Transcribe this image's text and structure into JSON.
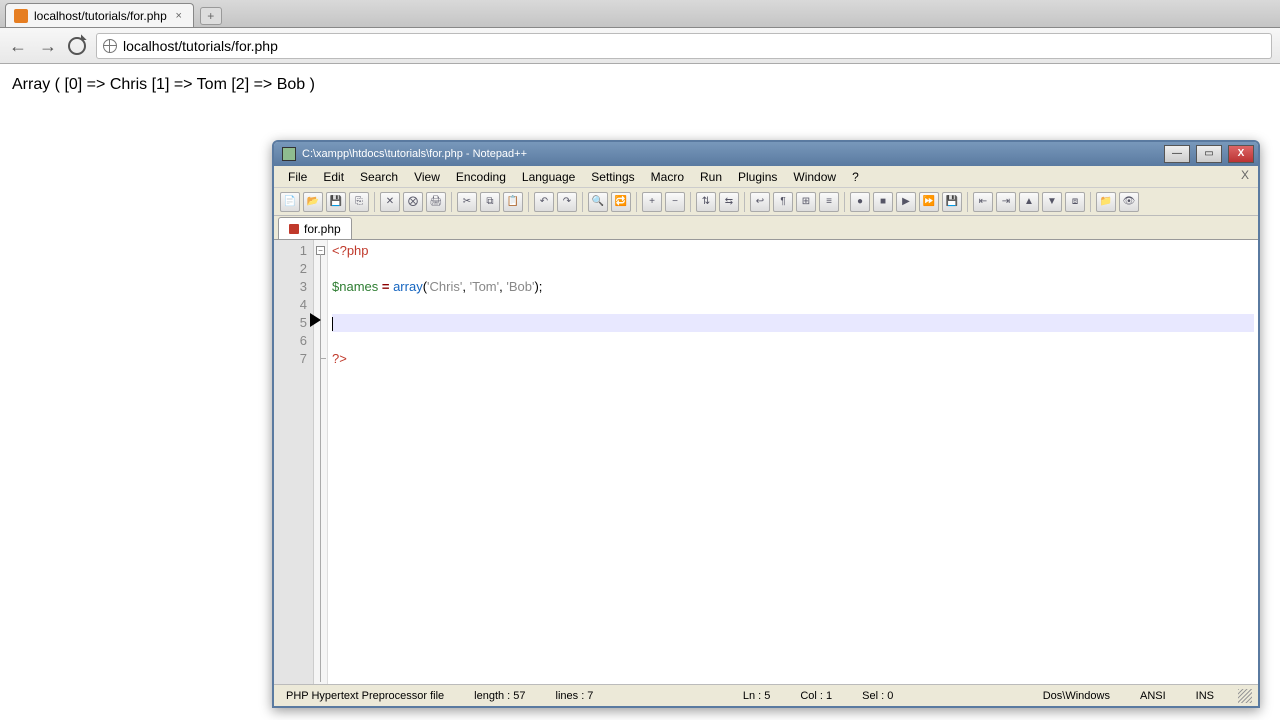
{
  "browser": {
    "tab_title": "localhost/tutorials/for.php",
    "url": "localhost/tutorials/for.php"
  },
  "page_output": "Array ( [0] => Chris [1] => Tom [2] => Bob )",
  "npp": {
    "title": "C:\\xampp\\htdocs\\tutorials\\for.php - Notepad++",
    "menu": [
      "File",
      "Edit",
      "Search",
      "View",
      "Encoding",
      "Language",
      "Settings",
      "Macro",
      "Run",
      "Plugins",
      "Window",
      "?"
    ],
    "tab": "for.php",
    "lines": [
      "1",
      "2",
      "3",
      "4",
      "5",
      "6",
      "7"
    ],
    "code": {
      "open_tag": "<?php",
      "var": "$names",
      "eq": " = ",
      "fn": "array",
      "paren_open": "(",
      "s1": "'Chris'",
      "c1": ", ",
      "s2": "'Tom'",
      "c2": ", ",
      "s3": "'Bob'",
      "paren_close": ");",
      "close_tag": "?>"
    },
    "status": {
      "lang": "PHP Hypertext Preprocessor file",
      "length": "length : 57",
      "lines": "lines : 7",
      "ln": "Ln : 5",
      "col": "Col : 1",
      "sel": "Sel : 0",
      "eol": "Dos\\Windows",
      "enc": "ANSI",
      "ins": "INS"
    }
  }
}
